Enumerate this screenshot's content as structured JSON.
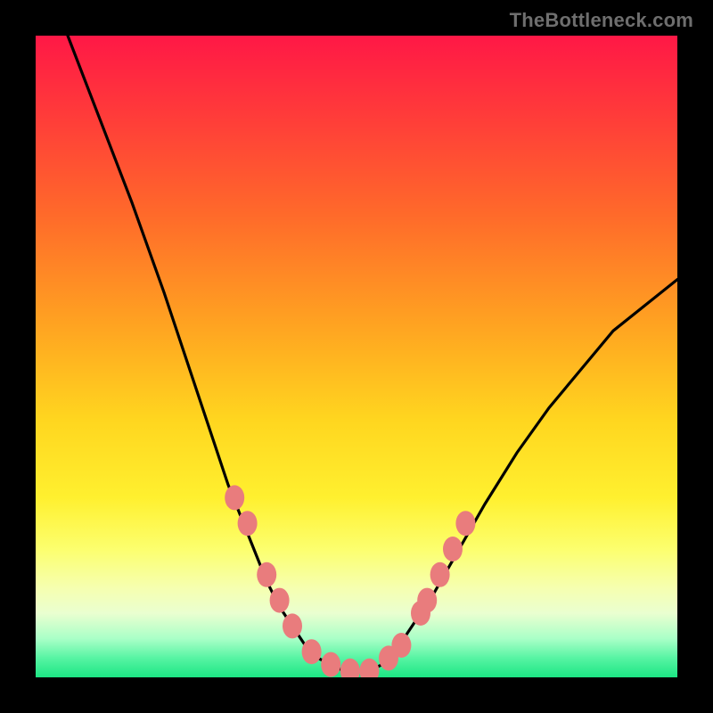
{
  "watermark": "TheBottleneck.com",
  "colors": {
    "bg": "#000000",
    "marker_fill": "#e97c7d",
    "curve_stroke": "#000000",
    "gradient_stops": [
      {
        "offset": 0.0,
        "color": "#ff1846"
      },
      {
        "offset": 0.12,
        "color": "#ff3a3a"
      },
      {
        "offset": 0.28,
        "color": "#ff6a2a"
      },
      {
        "offset": 0.45,
        "color": "#ffa321"
      },
      {
        "offset": 0.6,
        "color": "#ffd61f"
      },
      {
        "offset": 0.72,
        "color": "#fff02f"
      },
      {
        "offset": 0.8,
        "color": "#fcff6e"
      },
      {
        "offset": 0.86,
        "color": "#f6ffaf"
      },
      {
        "offset": 0.9,
        "color": "#eaffd0"
      },
      {
        "offset": 0.94,
        "color": "#a9ffc7"
      },
      {
        "offset": 0.97,
        "color": "#57f4a3"
      },
      {
        "offset": 1.0,
        "color": "#1ce684"
      }
    ]
  },
  "chart_data": {
    "type": "line",
    "title": "",
    "xlabel": "",
    "ylabel": "",
    "xlim": [
      0,
      100
    ],
    "ylim": [
      0,
      100
    ],
    "series": [
      {
        "name": "bottleneck-curve",
        "x": [
          5,
          10,
          15,
          20,
          25,
          28,
          30,
          32,
          34,
          36,
          38,
          40,
          42,
          44,
          46,
          48,
          50,
          52,
          54,
          56,
          58,
          62,
          66,
          70,
          75,
          80,
          85,
          90,
          95,
          100
        ],
        "y": [
          100,
          87,
          74,
          60,
          45,
          36,
          30,
          25,
          20,
          15,
          11,
          8,
          5,
          3,
          2,
          1,
          1,
          1,
          2,
          4,
          7,
          13,
          20,
          27,
          35,
          42,
          48,
          54,
          58,
          62
        ]
      }
    ],
    "markers": {
      "name": "highlight-points",
      "x": [
        31,
        33,
        36,
        38,
        40,
        43,
        46,
        49,
        52,
        55,
        57,
        60,
        61,
        63,
        65,
        67
      ],
      "y": [
        28,
        24,
        16,
        12,
        8,
        4,
        2,
        1,
        1,
        3,
        5,
        10,
        12,
        16,
        20,
        24
      ]
    }
  }
}
